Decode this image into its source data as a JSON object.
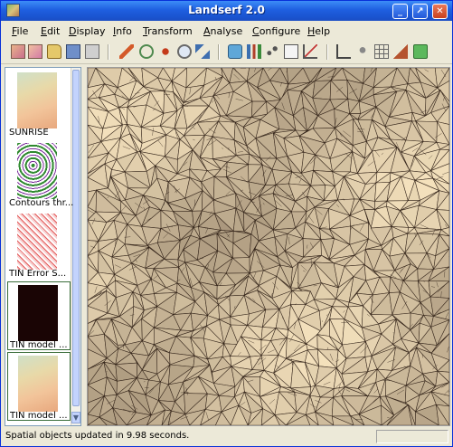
{
  "window": {
    "title": "Landserf 2.0"
  },
  "menu": [
    {
      "label": "File",
      "key": "F"
    },
    {
      "label": "Edit",
      "key": "E"
    },
    {
      "label": "Display",
      "key": "D"
    },
    {
      "label": "Info",
      "key": "I"
    },
    {
      "label": "Transform",
      "key": "T"
    },
    {
      "label": "Analyse",
      "key": "A"
    },
    {
      "label": "Configure",
      "key": "C"
    },
    {
      "label": "Help",
      "key": "H"
    }
  ],
  "toolbar_icons": [
    "new-raster-icon",
    "new-vector-icon",
    "open-folder-icon",
    "save-icon",
    "print-icon",
    "edit-pencil-icon",
    "refresh-icon",
    "pan-icon",
    "zoom-icon",
    "link-icon",
    "comment-icon",
    "bar-chart-icon",
    "scatter-plot-icon",
    "query-icon",
    "line-graph-icon",
    "angle-icon",
    "points-icon",
    "grid-icon",
    "terrain-icon",
    "help-icon"
  ],
  "thumbnails": [
    {
      "label": "SUNRISE",
      "kind": "terrain"
    },
    {
      "label": "Contours thr...",
      "kind": "contours"
    },
    {
      "label": "TIN Error S...",
      "kind": "error"
    },
    {
      "label": "TIN model ...",
      "kind": "dark"
    },
    {
      "label": "TIN model ...",
      "kind": "terrain"
    }
  ],
  "status": {
    "text": "Spatial objects updated in 9.98 seconds."
  },
  "colors": {
    "title_bar": "#1f5fe0",
    "map_base": "#d9cbb1",
    "mesh_line": "#2a1b12"
  }
}
